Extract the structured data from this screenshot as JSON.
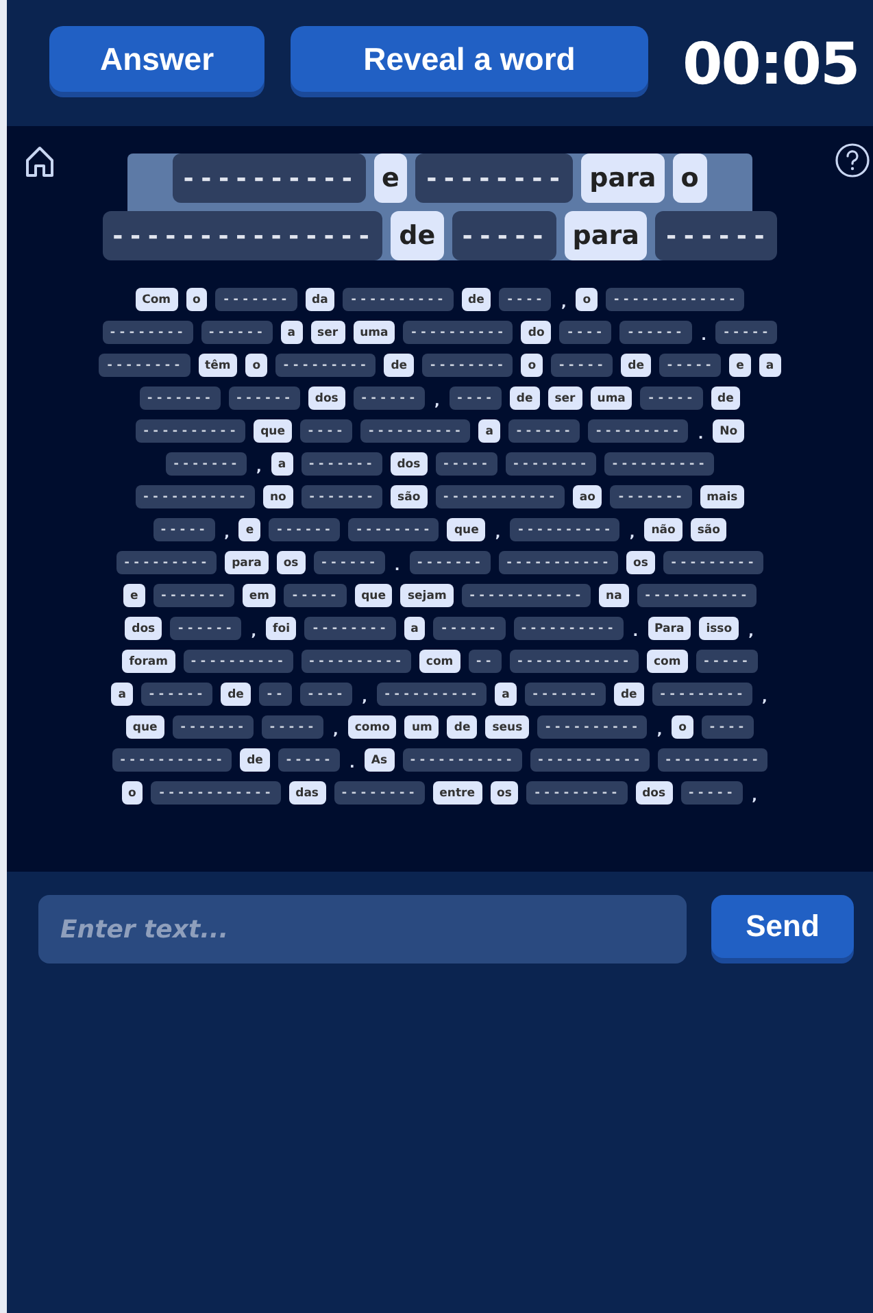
{
  "header": {
    "buttons": [
      "Answer",
      "Reveal a word"
    ],
    "timer": "00:05"
  },
  "title": [
    [
      {
        "kind": "hidden",
        "text": "----------"
      },
      {
        "kind": "word",
        "text": "e"
      },
      {
        "kind": "hidden",
        "text": "--------"
      },
      {
        "kind": "word",
        "text": "para"
      },
      {
        "kind": "word",
        "text": "o"
      }
    ],
    [
      {
        "kind": "hidden",
        "text": "---------------"
      },
      {
        "kind": "word",
        "text": "de"
      },
      {
        "kind": "hidden",
        "text": "-----"
      },
      {
        "kind": "word",
        "text": "para"
      },
      {
        "kind": "hidden",
        "text": "------"
      }
    ]
  ],
  "paragraph": [
    [
      {
        "kind": "word",
        "text": "Com"
      },
      {
        "kind": "word",
        "text": "o"
      },
      {
        "kind": "hidden",
        "text": "-------"
      },
      {
        "kind": "word",
        "text": "da"
      },
      {
        "kind": "hidden",
        "text": "----------"
      },
      {
        "kind": "word",
        "text": "de"
      },
      {
        "kind": "hidden",
        "text": "----"
      },
      {
        "kind": "punct",
        "text": ","
      },
      {
        "kind": "word",
        "text": "o"
      },
      {
        "kind": "hidden",
        "text": "-------------"
      }
    ],
    [
      {
        "kind": "hidden",
        "text": "--------"
      },
      {
        "kind": "hidden",
        "text": "------"
      },
      {
        "kind": "word",
        "text": "a"
      },
      {
        "kind": "word",
        "text": "ser"
      },
      {
        "kind": "word",
        "text": "uma"
      },
      {
        "kind": "hidden",
        "text": "----------"
      },
      {
        "kind": "word",
        "text": "do"
      },
      {
        "kind": "hidden",
        "text": "----"
      },
      {
        "kind": "hidden",
        "text": "------"
      },
      {
        "kind": "punct",
        "text": "."
      },
      {
        "kind": "hidden",
        "text": "-----"
      }
    ],
    [
      {
        "kind": "hidden",
        "text": "--------"
      },
      {
        "kind": "word",
        "text": "têm"
      },
      {
        "kind": "word",
        "text": "o"
      },
      {
        "kind": "hidden",
        "text": "---------"
      },
      {
        "kind": "word",
        "text": "de"
      },
      {
        "kind": "hidden",
        "text": "--------"
      },
      {
        "kind": "word",
        "text": "o"
      },
      {
        "kind": "hidden",
        "text": "-----"
      },
      {
        "kind": "word",
        "text": "de"
      },
      {
        "kind": "hidden",
        "text": "-----"
      },
      {
        "kind": "word",
        "text": "e"
      },
      {
        "kind": "word",
        "text": "a"
      }
    ],
    [
      {
        "kind": "hidden",
        "text": "-------"
      },
      {
        "kind": "hidden",
        "text": "------"
      },
      {
        "kind": "word",
        "text": "dos"
      },
      {
        "kind": "hidden",
        "text": "------"
      },
      {
        "kind": "punct",
        "text": ","
      },
      {
        "kind": "hidden",
        "text": "----"
      },
      {
        "kind": "word",
        "text": "de"
      },
      {
        "kind": "word",
        "text": "ser"
      },
      {
        "kind": "word",
        "text": "uma"
      },
      {
        "kind": "hidden",
        "text": "-----"
      },
      {
        "kind": "word",
        "text": "de"
      }
    ],
    [
      {
        "kind": "hidden",
        "text": "----------"
      },
      {
        "kind": "word",
        "text": "que"
      },
      {
        "kind": "hidden",
        "text": "----"
      },
      {
        "kind": "hidden",
        "text": "----------"
      },
      {
        "kind": "word",
        "text": "a"
      },
      {
        "kind": "hidden",
        "text": "------"
      },
      {
        "kind": "hidden",
        "text": "---------"
      },
      {
        "kind": "punct",
        "text": "."
      },
      {
        "kind": "word",
        "text": "No"
      }
    ],
    [
      {
        "kind": "hidden",
        "text": "-------"
      },
      {
        "kind": "punct",
        "text": ","
      },
      {
        "kind": "word",
        "text": "a"
      },
      {
        "kind": "hidden",
        "text": "-------"
      },
      {
        "kind": "word",
        "text": "dos"
      },
      {
        "kind": "hidden",
        "text": "-----"
      },
      {
        "kind": "hidden",
        "text": "--------"
      },
      {
        "kind": "hidden",
        "text": "----------"
      }
    ],
    [
      {
        "kind": "hidden",
        "text": "-----------"
      },
      {
        "kind": "word",
        "text": "no"
      },
      {
        "kind": "hidden",
        "text": "-------"
      },
      {
        "kind": "word",
        "text": "são"
      },
      {
        "kind": "hidden",
        "text": "------------"
      },
      {
        "kind": "word",
        "text": "ao"
      },
      {
        "kind": "hidden",
        "text": "-------"
      },
      {
        "kind": "word",
        "text": "mais"
      }
    ],
    [
      {
        "kind": "hidden",
        "text": "-----"
      },
      {
        "kind": "punct",
        "text": ","
      },
      {
        "kind": "word",
        "text": "e"
      },
      {
        "kind": "hidden",
        "text": "------"
      },
      {
        "kind": "hidden",
        "text": "--------"
      },
      {
        "kind": "word",
        "text": "que"
      },
      {
        "kind": "punct",
        "text": ","
      },
      {
        "kind": "hidden",
        "text": "----------"
      },
      {
        "kind": "punct",
        "text": ","
      },
      {
        "kind": "word",
        "text": "não"
      },
      {
        "kind": "word",
        "text": "são"
      }
    ],
    [
      {
        "kind": "hidden",
        "text": "---------"
      },
      {
        "kind": "word",
        "text": "para"
      },
      {
        "kind": "word",
        "text": "os"
      },
      {
        "kind": "hidden",
        "text": "------"
      },
      {
        "kind": "punct",
        "text": "."
      },
      {
        "kind": "hidden",
        "text": "-------"
      },
      {
        "kind": "hidden",
        "text": "-----------"
      },
      {
        "kind": "word",
        "text": "os"
      },
      {
        "kind": "hidden",
        "text": "---------"
      }
    ],
    [
      {
        "kind": "word",
        "text": "e"
      },
      {
        "kind": "hidden",
        "text": "-------"
      },
      {
        "kind": "word",
        "text": "em"
      },
      {
        "kind": "hidden",
        "text": "-----"
      },
      {
        "kind": "word",
        "text": "que"
      },
      {
        "kind": "word",
        "text": "sejam"
      },
      {
        "kind": "hidden",
        "text": "------------"
      },
      {
        "kind": "word",
        "text": "na"
      },
      {
        "kind": "hidden",
        "text": "-----------"
      }
    ],
    [
      {
        "kind": "word",
        "text": "dos"
      },
      {
        "kind": "hidden",
        "text": "------"
      },
      {
        "kind": "punct",
        "text": ","
      },
      {
        "kind": "word",
        "text": "foi"
      },
      {
        "kind": "hidden",
        "text": "--------"
      },
      {
        "kind": "word",
        "text": "a"
      },
      {
        "kind": "hidden",
        "text": "------"
      },
      {
        "kind": "hidden",
        "text": "----------"
      },
      {
        "kind": "punct",
        "text": "."
      },
      {
        "kind": "word",
        "text": "Para"
      },
      {
        "kind": "word",
        "text": "isso"
      },
      {
        "kind": "punct",
        "text": ","
      }
    ],
    [
      {
        "kind": "word",
        "text": "foram"
      },
      {
        "kind": "hidden",
        "text": "----------"
      },
      {
        "kind": "hidden",
        "text": "----------"
      },
      {
        "kind": "word",
        "text": "com"
      },
      {
        "kind": "hidden",
        "text": "--"
      },
      {
        "kind": "hidden",
        "text": "------------"
      },
      {
        "kind": "word",
        "text": "com"
      },
      {
        "kind": "hidden",
        "text": "-----"
      }
    ],
    [
      {
        "kind": "word",
        "text": "a"
      },
      {
        "kind": "hidden",
        "text": "------"
      },
      {
        "kind": "word",
        "text": "de"
      },
      {
        "kind": "hidden",
        "text": "--"
      },
      {
        "kind": "hidden",
        "text": "----"
      },
      {
        "kind": "punct",
        "text": ","
      },
      {
        "kind": "hidden",
        "text": "----------"
      },
      {
        "kind": "word",
        "text": "a"
      },
      {
        "kind": "hidden",
        "text": "-------"
      },
      {
        "kind": "word",
        "text": "de"
      },
      {
        "kind": "hidden",
        "text": "---------"
      },
      {
        "kind": "punct",
        "text": ","
      }
    ],
    [
      {
        "kind": "word",
        "text": "que"
      },
      {
        "kind": "hidden",
        "text": "-------"
      },
      {
        "kind": "hidden",
        "text": "-----"
      },
      {
        "kind": "punct",
        "text": ","
      },
      {
        "kind": "word",
        "text": "como"
      },
      {
        "kind": "word",
        "text": "um"
      },
      {
        "kind": "word",
        "text": "de"
      },
      {
        "kind": "word",
        "text": "seus"
      },
      {
        "kind": "hidden",
        "text": "----------"
      },
      {
        "kind": "punct",
        "text": ","
      },
      {
        "kind": "word",
        "text": "o"
      },
      {
        "kind": "hidden",
        "text": "----"
      }
    ],
    [
      {
        "kind": "hidden",
        "text": "-----------"
      },
      {
        "kind": "word",
        "text": "de"
      },
      {
        "kind": "hidden",
        "text": "-----"
      },
      {
        "kind": "punct",
        "text": "."
      },
      {
        "kind": "word",
        "text": "As"
      },
      {
        "kind": "hidden",
        "text": "-----------"
      },
      {
        "kind": "hidden",
        "text": "-----------"
      },
      {
        "kind": "hidden",
        "text": "----------"
      }
    ],
    [
      {
        "kind": "word",
        "text": "o"
      },
      {
        "kind": "hidden",
        "text": "------------"
      },
      {
        "kind": "word",
        "text": "das"
      },
      {
        "kind": "hidden",
        "text": "--------"
      },
      {
        "kind": "word",
        "text": "entre"
      },
      {
        "kind": "word",
        "text": "os"
      },
      {
        "kind": "hidden",
        "text": "---------"
      },
      {
        "kind": "word",
        "text": "dos"
      },
      {
        "kind": "hidden",
        "text": "-----"
      },
      {
        "kind": "punct",
        "text": ","
      }
    ]
  ],
  "input": {
    "placeholder": "Enter text...",
    "button": "Send"
  }
}
